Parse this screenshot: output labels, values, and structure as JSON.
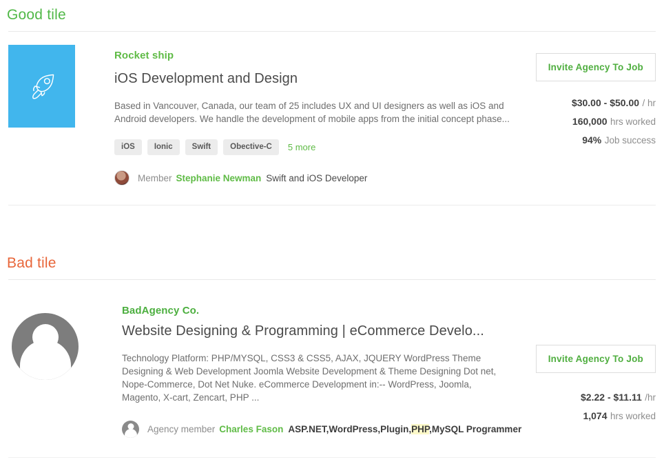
{
  "sections": [
    {
      "heading": "Good tile",
      "heading_color": "#51b848",
      "agency_name": "Rocket ship",
      "title": "iOS Development and Design",
      "description": "Based in Vancouver, Canada, our team of 25 includes UX and UI designers as well as iOS and Android developers. We handle the development of mobile apps from the initial concept phase...",
      "tags": [
        "iOS",
        "Ionic",
        "Swift",
        "Obective-C"
      ],
      "more_tags_label": "5 more",
      "member_label": "Member",
      "member_name": "Stephanie Newman",
      "member_role": "Swift and iOS Developer",
      "invite_button": "Invite Agency To Job",
      "rate_value": "$30.00 - $50.00",
      "rate_unit": "/ hr",
      "hours_value": "160,000",
      "hours_label": "hrs worked",
      "success_value": "94%",
      "success_label": "Job success",
      "logo_icon": "rocket-icon",
      "logo_color": "#41b6ed"
    },
    {
      "heading": "Bad tile",
      "heading_color": "#e8663a",
      "agency_name": "BadAgency Co.",
      "title": "Website Designing & Programming | eCommerce Develo...",
      "description": "Technology Platform: PHP/MYSQL, CSS3 & CSS5, AJAX, JQUERY WordPress Theme Designing & Web Development Joomla Website Development & Theme Designing Dot net, Nope-Commerce, Dot Net Nuke. eCommerce Development in:-- WordPress, Joomla, Magento, X-cart, Zencart, PHP ...",
      "member_label": "Agency member",
      "member_name": "Charles Fason",
      "member_role_part1": "ASP.NET,WordPress,Plugin,",
      "member_role_highlight": "PHP",
      "member_role_part2": ",MySQL Programmer",
      "invite_button": "Invite Agency To Job",
      "rate_value": "$2.22 - $11.11",
      "rate_unit": "/hr",
      "hours_value": "1,074",
      "hours_label": "hrs worked",
      "logo_icon": "user-placeholder-icon",
      "logo_color": "#7d7d7d"
    }
  ]
}
